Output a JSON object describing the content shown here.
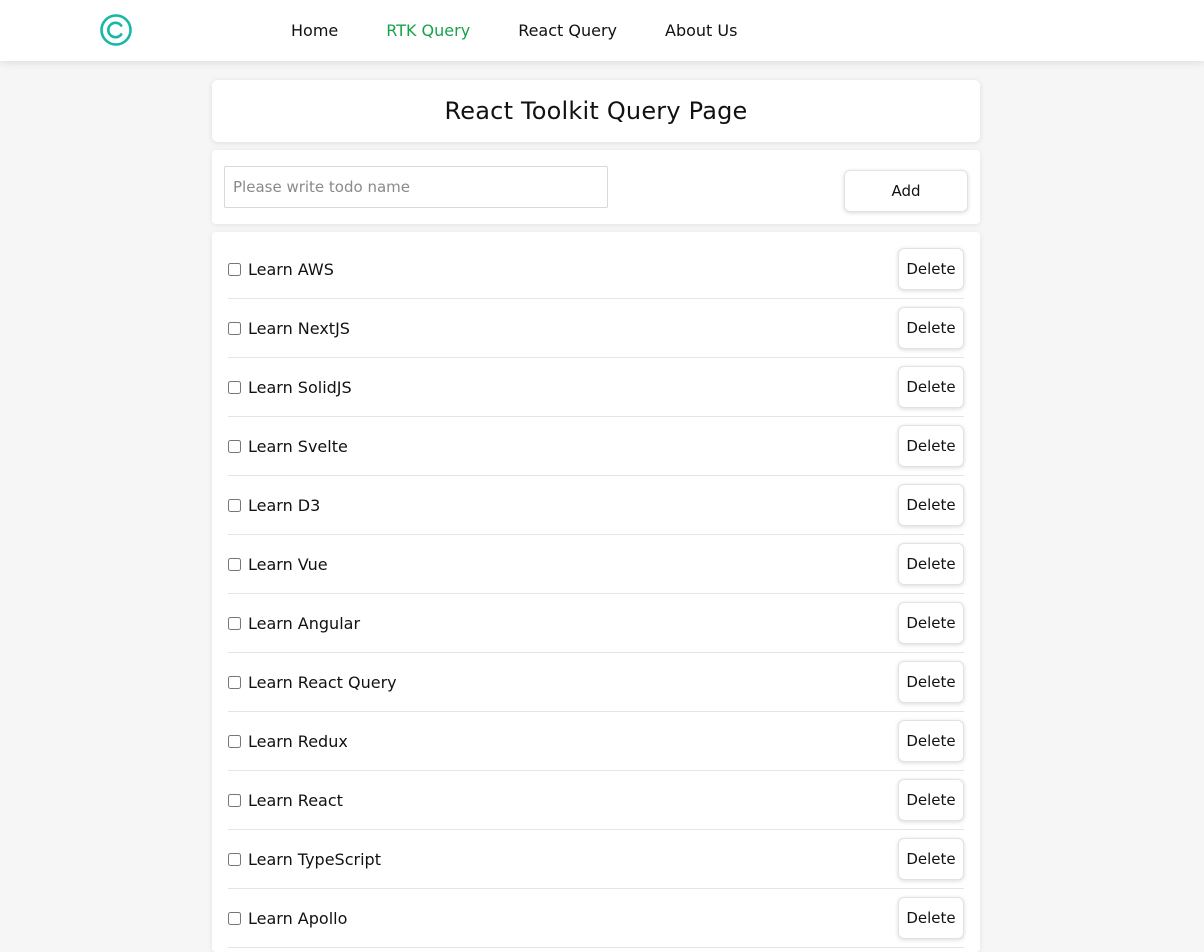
{
  "colors": {
    "brand": "#14b8a6",
    "active_link": "#16a34a"
  },
  "nav": {
    "logo_icon": "copyright-icon",
    "links": [
      {
        "label": "Home",
        "active": false
      },
      {
        "label": "RTK Query",
        "active": true
      },
      {
        "label": "React Query",
        "active": false
      },
      {
        "label": "About Us",
        "active": false
      }
    ]
  },
  "page": {
    "title": "React Toolkit Query Page"
  },
  "add_form": {
    "input_value": "",
    "input_placeholder": "Please write todo name",
    "add_label": "Add"
  },
  "todos": [
    {
      "label": "Learn AWS",
      "done": false,
      "delete_label": "Delete"
    },
    {
      "label": "Learn NextJS",
      "done": false,
      "delete_label": "Delete"
    },
    {
      "label": "Learn SolidJS",
      "done": false,
      "delete_label": "Delete"
    },
    {
      "label": "Learn Svelte",
      "done": false,
      "delete_label": "Delete"
    },
    {
      "label": "Learn D3",
      "done": false,
      "delete_label": "Delete"
    },
    {
      "label": "Learn Vue",
      "done": false,
      "delete_label": "Delete"
    },
    {
      "label": "Learn Angular",
      "done": false,
      "delete_label": "Delete"
    },
    {
      "label": "Learn React Query",
      "done": false,
      "delete_label": "Delete"
    },
    {
      "label": "Learn Redux",
      "done": false,
      "delete_label": "Delete"
    },
    {
      "label": "Learn React",
      "done": false,
      "delete_label": "Delete"
    },
    {
      "label": "Learn TypeScript",
      "done": false,
      "delete_label": "Delete"
    },
    {
      "label": "Learn Apollo",
      "done": false,
      "delete_label": "Delete"
    }
  ]
}
